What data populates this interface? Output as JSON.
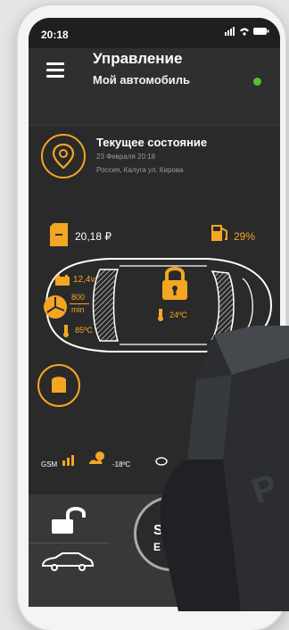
{
  "status_bar": {
    "time": "20:18"
  },
  "header": {
    "title": "Управление",
    "subtitle": "Мой автомобиль"
  },
  "state": {
    "title": "Текущее состояние",
    "date": "23 Февраля 20:18",
    "location": "Россия, Калуга ул. Кирова"
  },
  "balance": {
    "value": "20,18 ₽"
  },
  "fuel": {
    "value": "29%"
  },
  "battery": {
    "value": "12,4v"
  },
  "rpm": {
    "value": "800",
    "unit": "min"
  },
  "engine_temp": {
    "value": "85ºC"
  },
  "cabin_temp": {
    "value": "24ºC"
  },
  "gsm": {
    "label": "GSM"
  },
  "outside_temp": {
    "value": "-18ºC"
  },
  "start_button": {
    "line1": "ST",
    "line2": "E"
  },
  "colors": {
    "accent": "#f4a623",
    "online": "#5bbf2a"
  }
}
